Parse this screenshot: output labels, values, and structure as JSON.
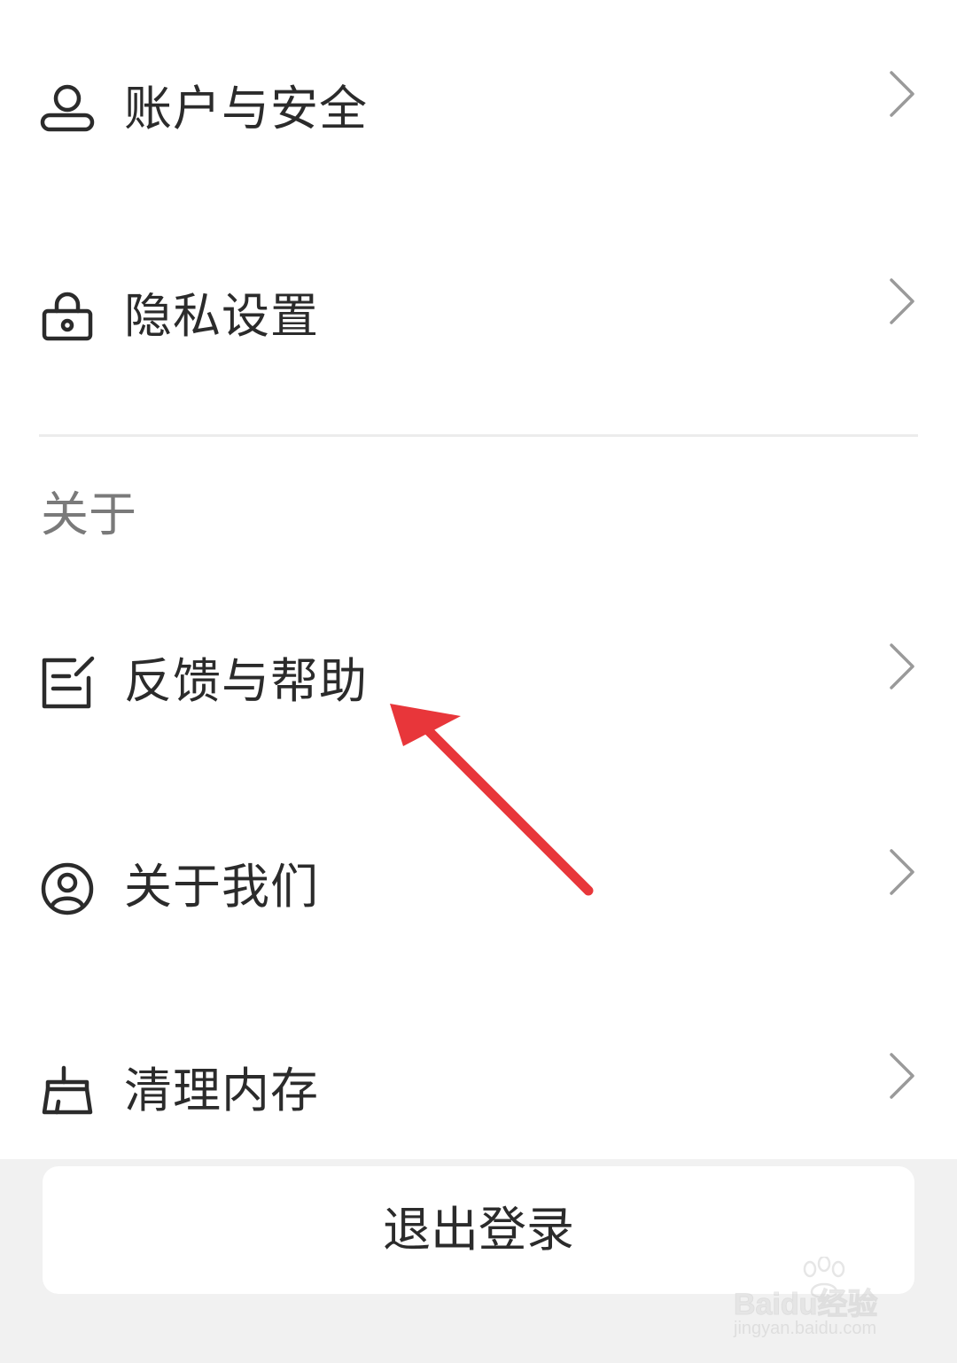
{
  "settings": {
    "account_security": {
      "label": "账户与安全",
      "icon": "user-icon"
    },
    "privacy": {
      "label": "隐私设置",
      "icon": "lock-icon"
    },
    "about_section_title": "关于",
    "feedback_help": {
      "label": "反馈与帮助",
      "icon": "edit-note-icon"
    },
    "about_us": {
      "label": "关于我们",
      "icon": "user-circle-icon"
    },
    "clear_cache": {
      "label": "清理内存",
      "icon": "broom-icon"
    }
  },
  "logout_label": "退出登录",
  "watermark": {
    "brand": "Baidu经验",
    "url": "jingyan.baidu.com"
  },
  "colors": {
    "text": "#2b2b2b",
    "section_text": "#7a7a7a",
    "chevron": "#9a9a9a",
    "divider": "#ececec",
    "footer_bg": "#f1f1f1",
    "annotation_arrow": "#e8363a"
  }
}
